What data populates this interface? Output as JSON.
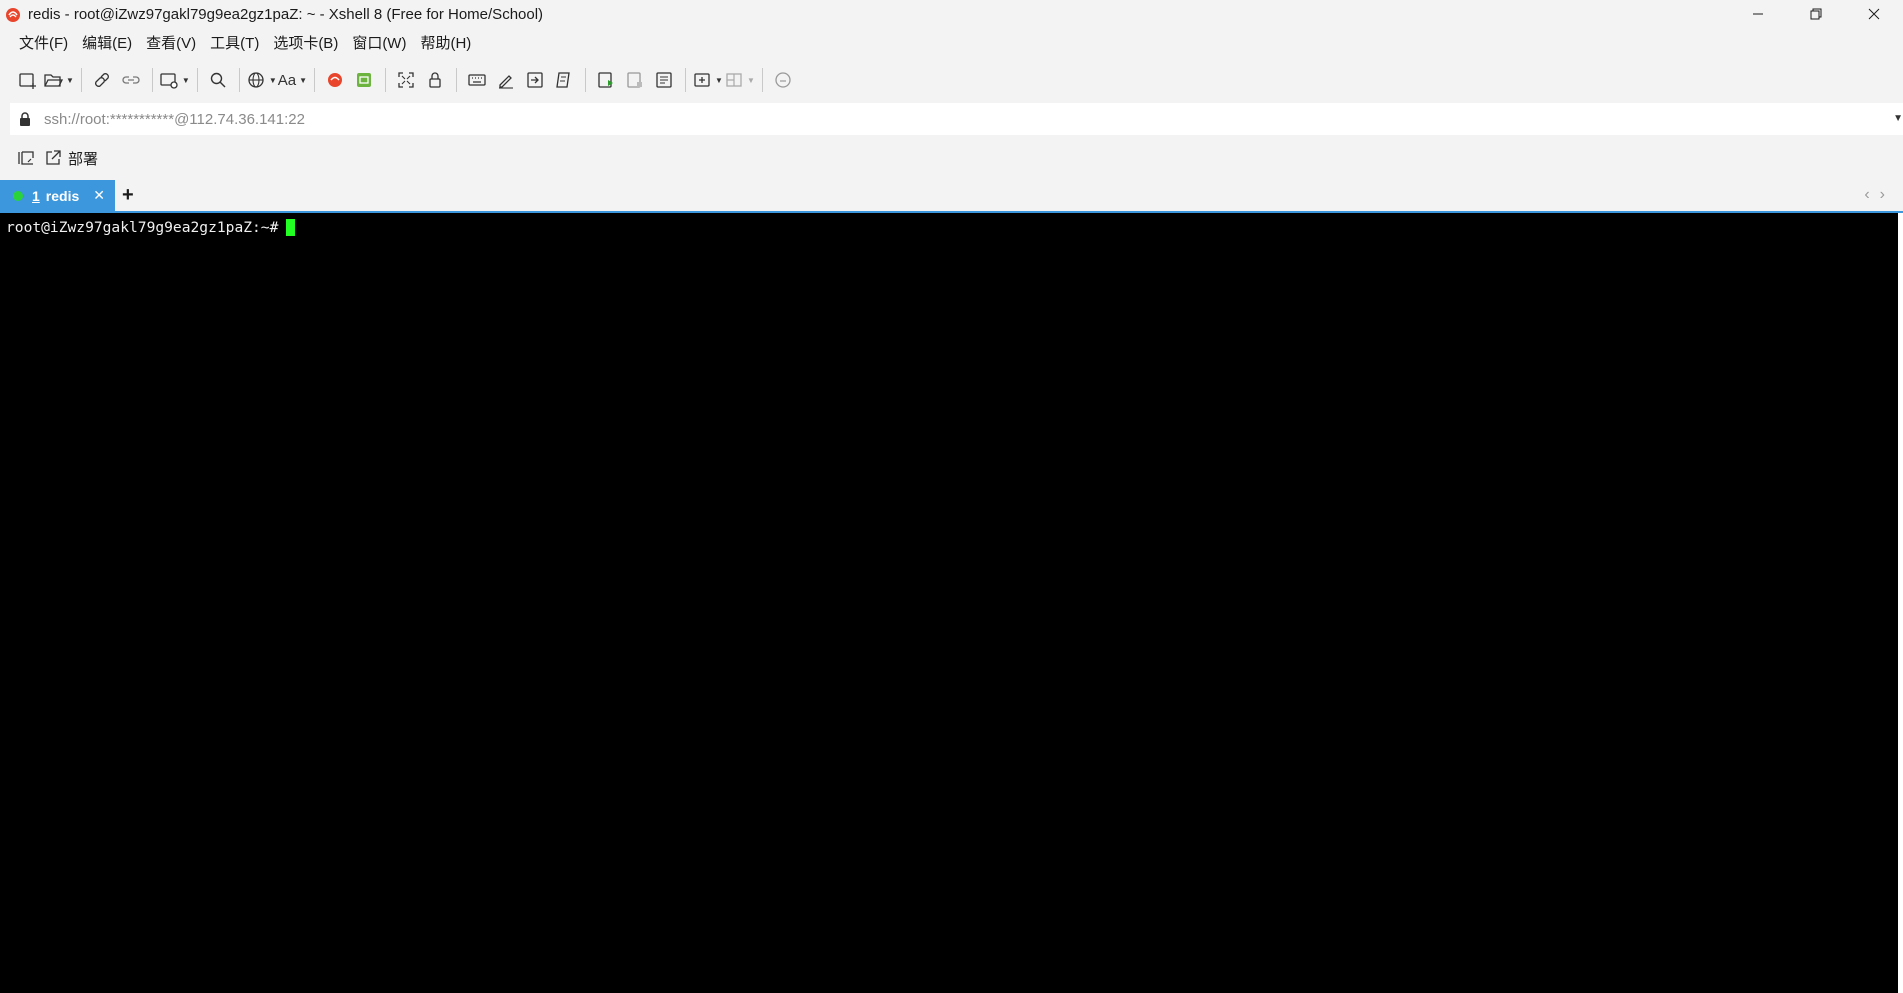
{
  "window": {
    "title": "redis - root@iZwz97gakl79g9ea2gz1paZ: ~ - Xshell 8 (Free for Home/School)",
    "app_icon": "xshell-logo-icon"
  },
  "menu": {
    "items": [
      {
        "label": "文件(F)"
      },
      {
        "label": "编辑(E)"
      },
      {
        "label": "查看(V)"
      },
      {
        "label": "工具(T)"
      },
      {
        "label": "选项卡(B)"
      },
      {
        "label": "窗口(W)"
      },
      {
        "label": "帮助(H)"
      }
    ]
  },
  "address": {
    "value": "ssh://root:***********@112.74.36.141:22"
  },
  "linkbar": {
    "deploy_label": "部署"
  },
  "tabs": {
    "active": {
      "number": "1",
      "label": "redis",
      "status_color": "#2ad33a"
    },
    "accent": "#3c97dc"
  },
  "terminal": {
    "prompt": "root@iZwz97gakl79g9ea2gz1paZ:~#",
    "cursor_color": "#22ff22",
    "background": "#000000"
  }
}
